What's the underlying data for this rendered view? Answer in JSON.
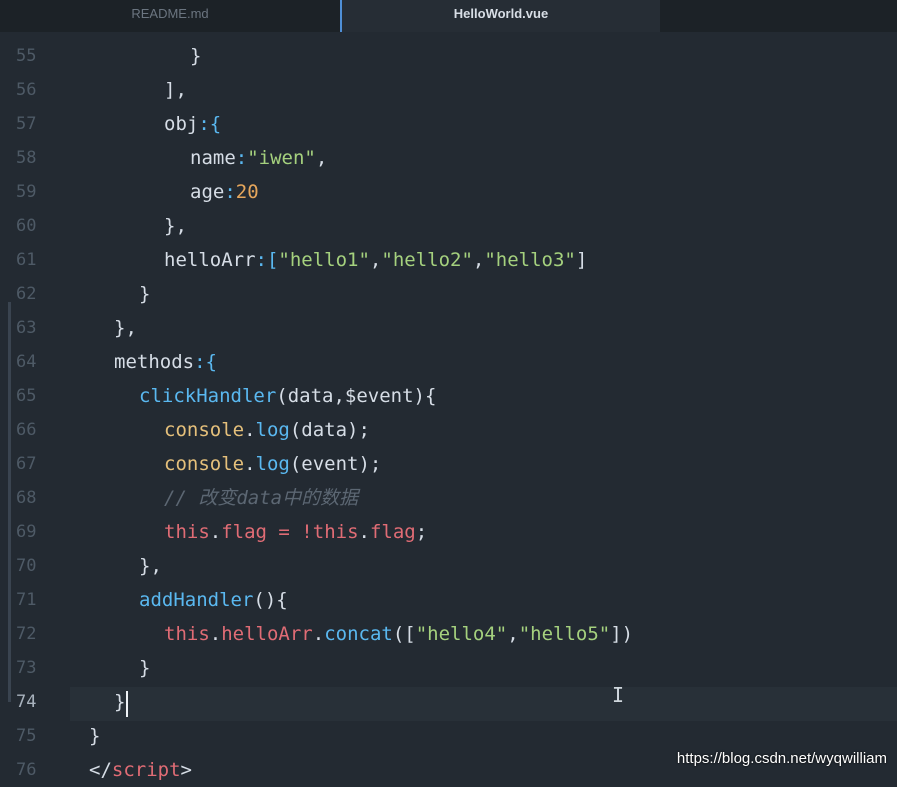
{
  "tabs": [
    {
      "label": "README.md",
      "active": false
    },
    {
      "label": "HelloWorld.vue",
      "active": true
    }
  ],
  "line_numbers": [
    "55",
    "56",
    "57",
    "58",
    "59",
    "60",
    "61",
    "62",
    "63",
    "64",
    "65",
    "66",
    "67",
    "68",
    "69",
    "70",
    "71",
    "72",
    "73",
    "74",
    "75",
    "76"
  ],
  "code": {
    "l55": "}",
    "l56": "],",
    "l57_key": "obj",
    "l57_rest": ":{",
    "l58_key": "name",
    "l58_colon": ":",
    "l58_val": "\"iwen\"",
    "l58_comma": ",",
    "l59_key": "age",
    "l59_colon": ":",
    "l59_val": "20",
    "l60": "},",
    "l61_key": "helloArr",
    "l61_a": ":[",
    "l61_v1": "\"hello1\"",
    "l61_c1": ",",
    "l61_v2": "\"hello2\"",
    "l61_c2": ",",
    "l61_v3": "\"hello3\"",
    "l61_end": "]",
    "l62": "}",
    "l63": "},",
    "l64_key": "methods",
    "l64_rest": ":{",
    "l65_fn": "clickHandler",
    "l65_rest": "(data,$event){",
    "l66_obj": "console",
    "l66_dot": ".",
    "l66_fn": "log",
    "l66_rest": "(data);",
    "l67_obj": "console",
    "l67_dot": ".",
    "l67_fn": "log",
    "l67_rest": "(event);",
    "l68_comment": "// 改变data中的数据",
    "l69_this1": "this",
    "l69_dot1": ".",
    "l69_prop1": "flag",
    "l69_op": " = !",
    "l69_this2": "this",
    "l69_dot2": ".",
    "l69_prop2": "flag",
    "l69_end": ";",
    "l70": "},",
    "l71_fn": "addHandler",
    "l71_rest": "(){",
    "l72_this": "this",
    "l72_dot1": ".",
    "l72_prop": "helloArr",
    "l72_dot2": ".",
    "l72_fn": "concat",
    "l72_a": "([",
    "l72_v1": "\"hello4\"",
    "l72_c": ",",
    "l72_v2": "\"hello5\"",
    "l72_end": "])",
    "l73": "}",
    "l74": "}",
    "l75": "}",
    "l76_open": "</",
    "l76_tag": "script",
    "l76_close": ">"
  },
  "watermark": "https://blog.csdn.net/wyqwilliam",
  "colors": {
    "background": "#232a32",
    "keyword": "#e06c75",
    "string": "#a5d17e",
    "number": "#e5a65c",
    "function": "#5ab8f0",
    "comment": "#5c6773"
  }
}
